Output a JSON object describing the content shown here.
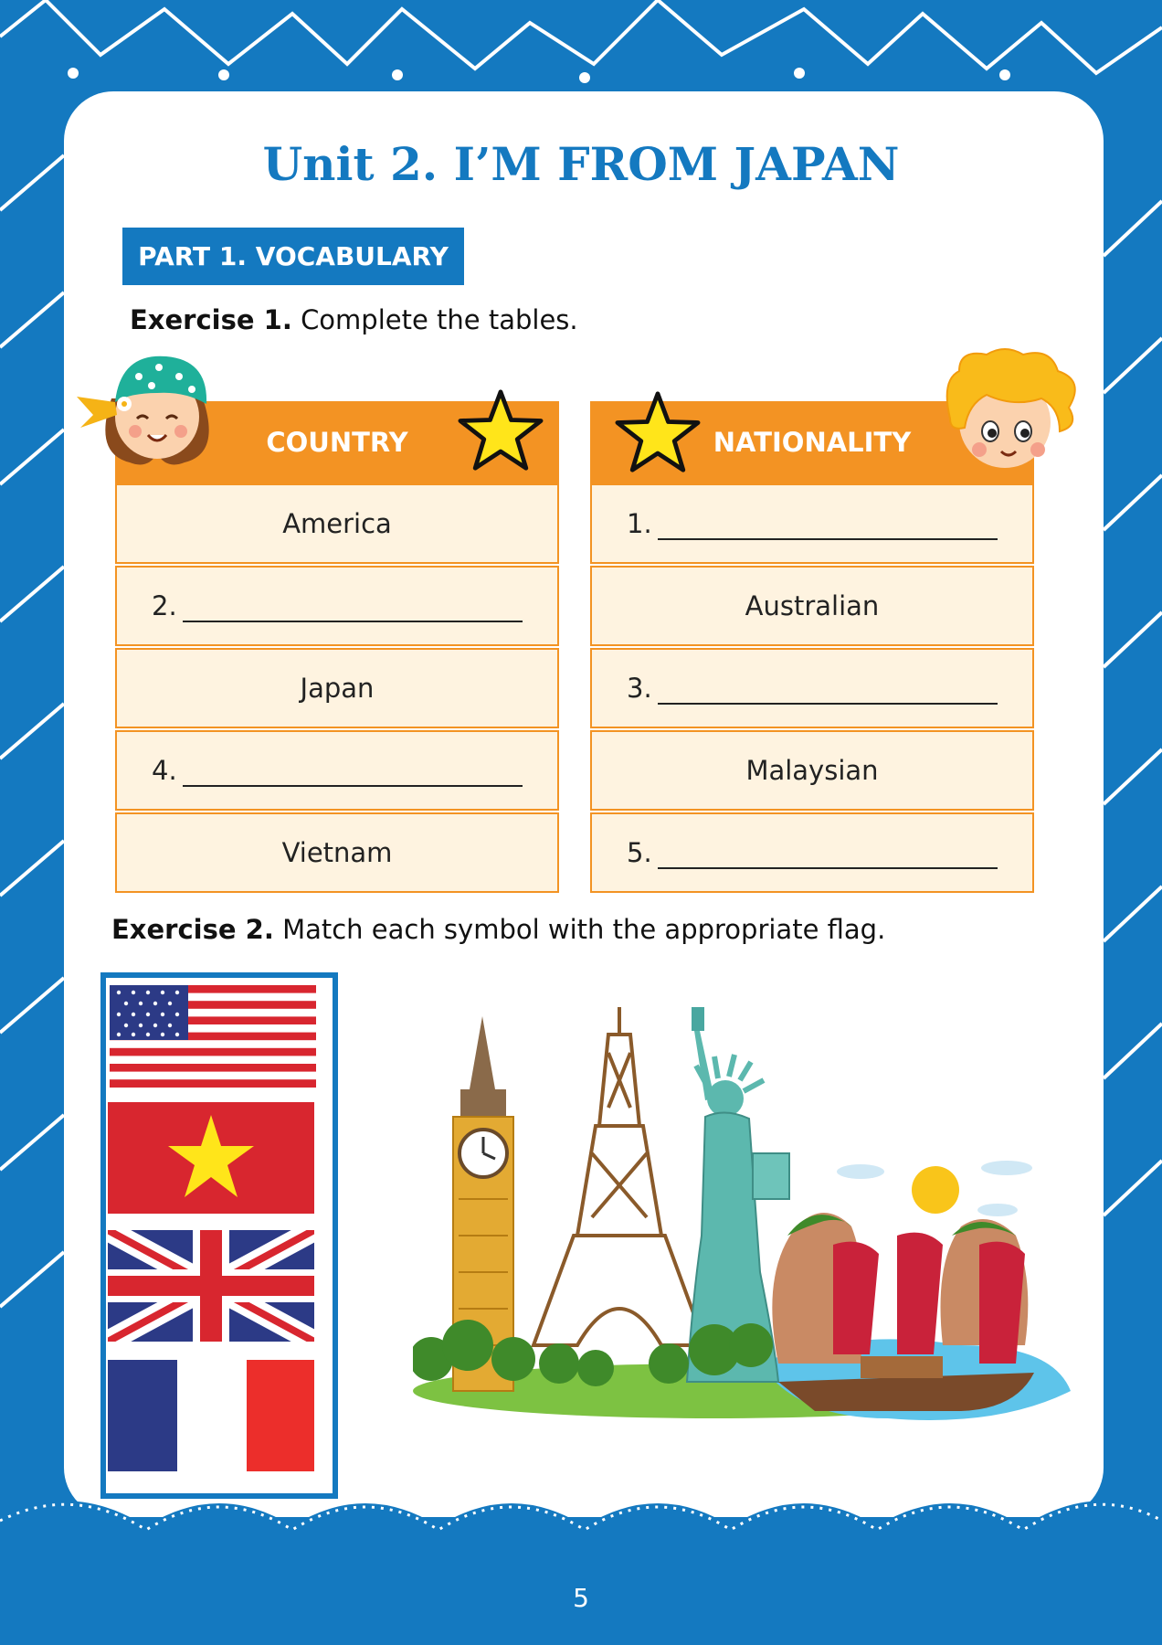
{
  "unit_title": "Unit 2. I’M FROM JAPAN",
  "part_label": "PART 1. VOCABULARY",
  "exercise1": {
    "label": "Exercise 1.",
    "instruction": "Complete the tables."
  },
  "tables": {
    "country": {
      "header": "COUNTRY",
      "rows": [
        {
          "text": "America",
          "number": ""
        },
        {
          "text": "",
          "number": "2."
        },
        {
          "text": "Japan",
          "number": ""
        },
        {
          "text": "",
          "number": "4."
        },
        {
          "text": "Vietnam",
          "number": ""
        }
      ]
    },
    "nationality": {
      "header": "NATIONALITY",
      "rows": [
        {
          "text": "",
          "number": "1."
        },
        {
          "text": "Australian",
          "number": ""
        },
        {
          "text": "",
          "number": "3."
        },
        {
          "text": "Malaysian",
          "number": ""
        },
        {
          "text": "",
          "number": "5."
        }
      ]
    }
  },
  "exercise2": {
    "label": "Exercise 2.",
    "instruction": "Match each symbol with the appropriate flag."
  },
  "flags": [
    "usa-flag",
    "vietnam-flag",
    "uk-flag",
    "france-flag"
  ],
  "landmarks": [
    "big-ben",
    "eiffel-tower",
    "statue-of-liberty",
    "ha-long-bay-junk-boats"
  ],
  "page_number": "5",
  "colors": {
    "blue": "#1479c0",
    "orange": "#f39323",
    "cell": "#fef3e0",
    "star": "#ffe51a"
  }
}
